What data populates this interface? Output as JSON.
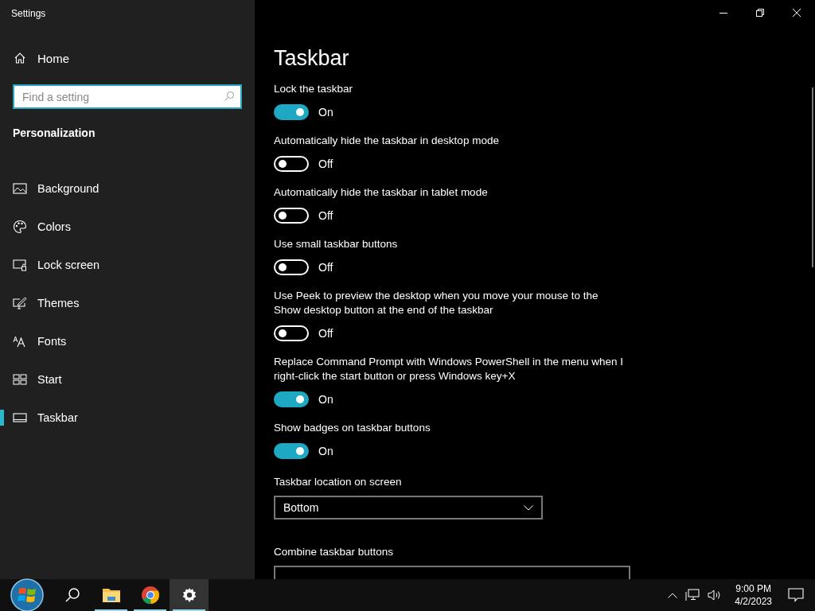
{
  "window": {
    "title": "Settings"
  },
  "sidebar": {
    "home": "Home",
    "search": {
      "placeholder": "Find a setting"
    },
    "section": "Personalization",
    "items": [
      {
        "label": "Background",
        "selected": false
      },
      {
        "label": "Colors",
        "selected": false
      },
      {
        "label": "Lock screen",
        "selected": false
      },
      {
        "label": "Themes",
        "selected": false
      },
      {
        "label": "Fonts",
        "selected": false
      },
      {
        "label": "Start",
        "selected": false
      },
      {
        "label": "Taskbar",
        "selected": true
      }
    ]
  },
  "page": {
    "title": "Taskbar",
    "settings": [
      {
        "kind": "toggle",
        "label": "Lock the taskbar",
        "on": true,
        "state_text": "On"
      },
      {
        "kind": "toggle",
        "label": "Automatically hide the taskbar in desktop mode",
        "on": false,
        "state_text": "Off"
      },
      {
        "kind": "toggle",
        "label": "Automatically hide the taskbar in tablet mode",
        "on": false,
        "state_text": "Off"
      },
      {
        "kind": "toggle",
        "label": "Use small taskbar buttons",
        "on": false,
        "state_text": "Off"
      },
      {
        "kind": "toggle",
        "label": "Use Peek to preview the desktop when you move your mouse to the Show desktop button at the end of the taskbar",
        "on": false,
        "state_text": "Off"
      },
      {
        "kind": "toggle",
        "label": "Replace Command Prompt with Windows PowerShell in the menu when I right-click the start button or press Windows key+X",
        "on": true,
        "state_text": "On"
      },
      {
        "kind": "toggle",
        "label": "Show badges on taskbar buttons",
        "on": true,
        "state_text": "On"
      },
      {
        "kind": "dropdown",
        "label": "Taskbar location on screen",
        "value": "Bottom"
      },
      {
        "kind": "dropdown",
        "label": "Combine taskbar buttons"
      }
    ]
  },
  "taskbar": {
    "apps": [
      {
        "running": false,
        "selected": false
      },
      {
        "running": true,
        "selected": false
      },
      {
        "running": true,
        "selected": false
      },
      {
        "running": true,
        "selected": true
      }
    ],
    "time": "9:00 PM",
    "date": "4/2/2023"
  }
}
